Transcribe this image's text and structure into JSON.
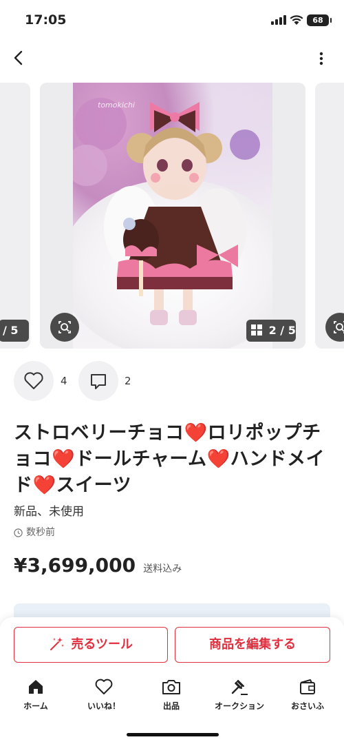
{
  "status_bar": {
    "time": "17:05",
    "battery": "68"
  },
  "gallery": {
    "prev_counter": "/ 5",
    "counter": "2 / 5",
    "watermark": "tomokichi"
  },
  "actions": {
    "likes": "4",
    "comments": "2"
  },
  "item": {
    "title": "ストロベリーチョコ❤️ロリポップチョコ❤️ドールチャーム❤️ハンドメイド❤️スイーツ",
    "condition": "新品、未使用",
    "posted": "数秒前",
    "price": "¥3,699,000",
    "shipping": "送料込み"
  },
  "buttons": {
    "sell_tool": "売るツール",
    "edit_item": "商品を編集する"
  },
  "tabs": [
    {
      "label": "ホーム"
    },
    {
      "label": "いいね！"
    },
    {
      "label": "出品"
    },
    {
      "label": "オークション"
    },
    {
      "label": "おさいふ"
    }
  ],
  "colors": {
    "accent": "#e0303f",
    "text": "#222222",
    "badge": "#4a4a4a"
  }
}
